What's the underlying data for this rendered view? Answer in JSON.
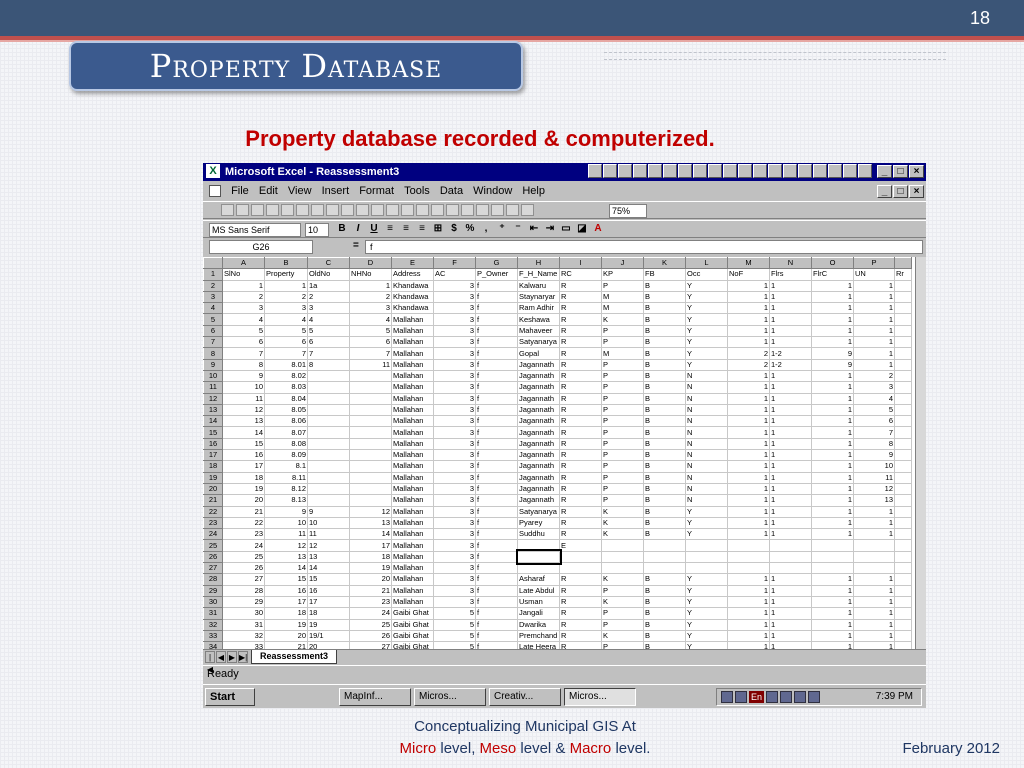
{
  "slide": {
    "number": "18",
    "title": "Property Database",
    "subtitle": "Property database recorded & computerized.",
    "footer_line1": "Conceptualizing Municipal GIS At",
    "footer_micro": "Micro",
    "footer_level1": " level, ",
    "footer_meso": "Meso",
    "footer_level2": " level & ",
    "footer_macro": "Macro",
    "footer_level3": " level.",
    "date": "February 2012"
  },
  "excel": {
    "window_title": "Microsoft Excel - Reassessment3",
    "menus": [
      "File",
      "Edit",
      "View",
      "Insert",
      "Format",
      "Tools",
      "Data",
      "Window",
      "Help"
    ],
    "zoom": "75%",
    "font_name": "MS Sans Serif",
    "font_size": "10",
    "name_box": "G26",
    "formula_label": "=",
    "formula_value": "f",
    "sheet_tab": "Reassessment3",
    "status": "Ready",
    "columns": [
      "",
      "A",
      "B",
      "C",
      "D",
      "E",
      "F",
      "G",
      "H",
      "I",
      "J",
      "K",
      "L",
      "M",
      "N",
      "O",
      "P"
    ],
    "rows": [
      [
        "1",
        "SlNo",
        "Property",
        "OldNo",
        "NHNo",
        "Address",
        "AC",
        "P_Owner",
        "F_H_Name",
        "RC",
        "KP",
        "FB",
        "Occ",
        "NoF",
        "Flrs",
        "FlrC",
        "UN",
        "Rr"
      ],
      [
        "2",
        "1",
        "1",
        "1a",
        "1",
        "Khandawa",
        "3",
        "f",
        "Kalwaru",
        "R",
        "P",
        "B",
        "Y",
        "1",
        "1",
        "1",
        "1"
      ],
      [
        "3",
        "2",
        "2",
        "2",
        "2",
        "Khandawa",
        "3",
        "f",
        "Staynaryar",
        "R",
        "M",
        "B",
        "Y",
        "1",
        "1",
        "1",
        "1"
      ],
      [
        "4",
        "3",
        "3",
        "3",
        "3",
        "Khandawa",
        "3",
        "f",
        "Ram Adhir",
        "R",
        "M",
        "B",
        "Y",
        "1",
        "1",
        "1",
        "1"
      ],
      [
        "5",
        "4",
        "4",
        "4",
        "4",
        "Mallahan",
        "3",
        "f",
        "Keshawa",
        "R",
        "K",
        "B",
        "Y",
        "1",
        "1",
        "1",
        "1"
      ],
      [
        "6",
        "5",
        "5",
        "5",
        "5",
        "Mallahan",
        "3",
        "f",
        "Mahaveer",
        "R",
        "P",
        "B",
        "Y",
        "1",
        "1",
        "1",
        "1"
      ],
      [
        "7",
        "6",
        "6",
        "6",
        "6",
        "Mallahan",
        "3",
        "f",
        "Satyanarya",
        "R",
        "P",
        "B",
        "Y",
        "1",
        "1",
        "1",
        "1"
      ],
      [
        "8",
        "7",
        "7",
        "7",
        "7",
        "Mallahan",
        "3",
        "f",
        "Gopal",
        "R",
        "M",
        "B",
        "Y",
        "2",
        "1-2",
        "9",
        "1"
      ],
      [
        "9",
        "8",
        "8.01",
        "8",
        "11",
        "Mallahan",
        "3",
        "f",
        "Jagannath",
        "R",
        "P",
        "B",
        "Y",
        "2",
        "1-2",
        "9",
        "1"
      ],
      [
        "10",
        "9",
        "8.02",
        "",
        "",
        "Mallahan",
        "3",
        "f",
        "Jagannath",
        "R",
        "P",
        "B",
        "N",
        "1",
        "1",
        "1",
        "2"
      ],
      [
        "11",
        "10",
        "8.03",
        "",
        "",
        "Mallahan",
        "3",
        "f",
        "Jagannath",
        "R",
        "P",
        "B",
        "N",
        "1",
        "1",
        "1",
        "3"
      ],
      [
        "12",
        "11",
        "8.04",
        "",
        "",
        "Mallahan",
        "3",
        "f",
        "Jagannath",
        "R",
        "P",
        "B",
        "N",
        "1",
        "1",
        "1",
        "4"
      ],
      [
        "13",
        "12",
        "8.05",
        "",
        "",
        "Mallahan",
        "3",
        "f",
        "Jagannath",
        "R",
        "P",
        "B",
        "N",
        "1",
        "1",
        "1",
        "5"
      ],
      [
        "14",
        "13",
        "8.06",
        "",
        "",
        "Mallahan",
        "3",
        "f",
        "Jagannath",
        "R",
        "P",
        "B",
        "N",
        "1",
        "1",
        "1",
        "6"
      ],
      [
        "15",
        "14",
        "8.07",
        "",
        "",
        "Mallahan",
        "3",
        "f",
        "Jagannath",
        "R",
        "P",
        "B",
        "N",
        "1",
        "1",
        "1",
        "7"
      ],
      [
        "16",
        "15",
        "8.08",
        "",
        "",
        "Mallahan",
        "3",
        "f",
        "Jagannath",
        "R",
        "P",
        "B",
        "N",
        "1",
        "1",
        "1",
        "8"
      ],
      [
        "17",
        "16",
        "8.09",
        "",
        "",
        "Mallahan",
        "3",
        "f",
        "Jagannath",
        "R",
        "P",
        "B",
        "N",
        "1",
        "1",
        "1",
        "9"
      ],
      [
        "18",
        "17",
        "8.1",
        "",
        "",
        "Mallahan",
        "3",
        "f",
        "Jagannath",
        "R",
        "P",
        "B",
        "N",
        "1",
        "1",
        "1",
        "10"
      ],
      [
        "19",
        "18",
        "8.11",
        "",
        "",
        "Mallahan",
        "3",
        "f",
        "Jagannath",
        "R",
        "P",
        "B",
        "N",
        "1",
        "1",
        "1",
        "11"
      ],
      [
        "20",
        "19",
        "8.12",
        "",
        "",
        "Mallahan",
        "3",
        "f",
        "Jagannath",
        "R",
        "P",
        "B",
        "N",
        "1",
        "1",
        "1",
        "12"
      ],
      [
        "21",
        "20",
        "8.13",
        "",
        "",
        "Mallahan",
        "3",
        "f",
        "Jagannath",
        "R",
        "P",
        "B",
        "N",
        "1",
        "1",
        "1",
        "13"
      ],
      [
        "22",
        "21",
        "9",
        "9",
        "12",
        "Mallahan",
        "3",
        "f",
        "Satyanarya",
        "R",
        "K",
        "B",
        "Y",
        "1",
        "1",
        "1",
        "1"
      ],
      [
        "23",
        "22",
        "10",
        "10",
        "13",
        "Mallahan",
        "3",
        "f",
        "Pyarey",
        "R",
        "K",
        "B",
        "Y",
        "1",
        "1",
        "1",
        "1"
      ],
      [
        "24",
        "23",
        "11",
        "11",
        "14",
        "Mallahan",
        "3",
        "f",
        "Suddhu",
        "R",
        "K",
        "B",
        "Y",
        "1",
        "1",
        "1",
        "1"
      ],
      [
        "25",
        "24",
        "12",
        "12",
        "17",
        "Mallahan",
        "3",
        "f",
        "",
        "E",
        "",
        "",
        "",
        "",
        "",
        "",
        ""
      ],
      [
        "26",
        "25",
        "13",
        "13",
        "18",
        "Mallahan",
        "3",
        "f",
        "",
        "",
        "",
        "",
        "",
        "",
        "",
        "",
        ""
      ],
      [
        "27",
        "26",
        "14",
        "14",
        "19",
        "Mallahan",
        "3",
        "f",
        "",
        "",
        "",
        "",
        "",
        "",
        "",
        "",
        ""
      ],
      [
        "28",
        "27",
        "15",
        "15",
        "20",
        "Mallahan",
        "3",
        "f",
        "Asharaf",
        "R",
        "K",
        "B",
        "Y",
        "1",
        "1",
        "1",
        "1"
      ],
      [
        "29",
        "28",
        "16",
        "16",
        "21",
        "Mallahan",
        "3",
        "f",
        "Late Abdul",
        "R",
        "P",
        "B",
        "Y",
        "1",
        "1",
        "1",
        "1"
      ],
      [
        "30",
        "29",
        "17",
        "17",
        "23",
        "Mallahan",
        "3",
        "f",
        "Usman",
        "R",
        "K",
        "B",
        "Y",
        "1",
        "1",
        "1",
        "1"
      ],
      [
        "31",
        "30",
        "18",
        "18",
        "24",
        "Gaibi Ghat",
        "5",
        "f",
        "Jangali",
        "R",
        "P",
        "B",
        "Y",
        "1",
        "1",
        "1",
        "1"
      ],
      [
        "32",
        "31",
        "19",
        "19",
        "25",
        "Gaibi Ghat",
        "5",
        "f",
        "Dwarika",
        "R",
        "P",
        "B",
        "Y",
        "1",
        "1",
        "1",
        "1"
      ],
      [
        "33",
        "32",
        "20",
        "19/1",
        "26",
        "Gaibi Ghat",
        "5",
        "f",
        "Premchand",
        "R",
        "K",
        "B",
        "Y",
        "1",
        "1",
        "1",
        "1"
      ],
      [
        "34",
        "33",
        "21",
        "20",
        "27",
        "Gaibi Ghat",
        "5",
        "f",
        "Late Heera",
        "R",
        "P",
        "B",
        "Y",
        "1",
        "1",
        "1",
        "1"
      ]
    ],
    "taskbar": {
      "start": "Start",
      "tasks": [
        "MapInf...",
        "Micros...",
        "Creativ...",
        "Micros..."
      ],
      "tray_lang": "En",
      "clock": "7:39 PM"
    }
  }
}
